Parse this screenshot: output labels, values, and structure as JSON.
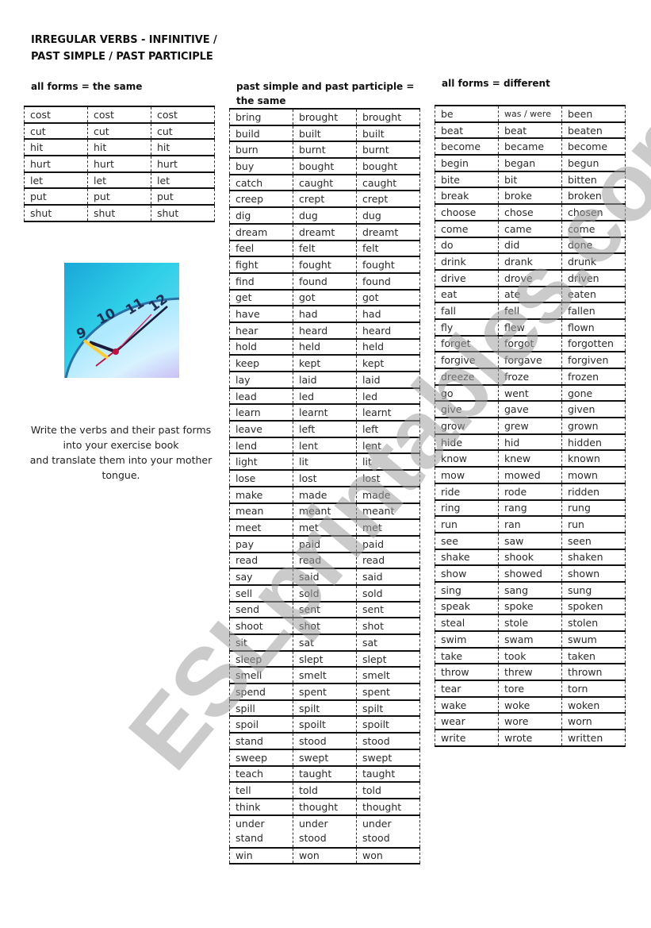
{
  "title_lines": [
    "IRREGULAR VERBS - INFINITIVE /",
    "PAST SIMPLE / PAST PARTICIPLE"
  ],
  "sections": {
    "same": {
      "heading": "all forms = the same",
      "rows": [
        [
          "cost",
          "cost",
          "cost"
        ],
        [
          "cut",
          "cut",
          "cut"
        ],
        [
          "hit",
          "hit",
          "hit"
        ],
        [
          "hurt",
          "hurt",
          "hurt"
        ],
        [
          "let",
          "let",
          "let"
        ],
        [
          "put",
          "put",
          "put"
        ],
        [
          "shut",
          "shut",
          "shut"
        ]
      ]
    },
    "past_same": {
      "heading_lines": [
        "past simple and past participle =",
        "the same"
      ],
      "rows": [
        [
          "bring",
          "brought",
          "brought"
        ],
        [
          "build",
          "built",
          "built"
        ],
        [
          "burn",
          "burnt",
          "burnt"
        ],
        [
          "buy",
          "bought",
          "bought"
        ],
        [
          "catch",
          "caught",
          "caught"
        ],
        [
          "creep",
          "crept",
          "crept"
        ],
        [
          "dig",
          "dug",
          "dug"
        ],
        [
          "dream",
          "dreamt",
          "dreamt"
        ],
        [
          "feel",
          "felt",
          "felt"
        ],
        [
          "fight",
          "fought",
          "fought"
        ],
        [
          "find",
          "found",
          "found"
        ],
        [
          "get",
          "got",
          "got"
        ],
        [
          "have",
          "had",
          "had"
        ],
        [
          "hear",
          "heard",
          "heard"
        ],
        [
          "hold",
          "held",
          "held"
        ],
        [
          "keep",
          "kept",
          "kept"
        ],
        [
          "lay",
          "laid",
          "laid"
        ],
        [
          "lead",
          "led",
          "led"
        ],
        [
          "learn",
          "learnt",
          "learnt"
        ],
        [
          "leave",
          "left",
          "left"
        ],
        [
          "lend",
          "lent",
          "lent"
        ],
        [
          "light",
          "lit",
          "lit"
        ],
        [
          "lose",
          "lost",
          "lost"
        ],
        [
          "make",
          "made",
          "made"
        ],
        [
          "mean",
          "meant",
          "meant"
        ],
        [
          "meet",
          "met",
          "met"
        ],
        [
          "pay",
          "paid",
          "paid"
        ],
        [
          "read",
          "read",
          "read"
        ],
        [
          "say",
          "said",
          "said"
        ],
        [
          "sell",
          "sold",
          "sold"
        ],
        [
          "send",
          "sent",
          "sent"
        ],
        [
          "shoot",
          "shot",
          "shot"
        ],
        [
          "sit",
          "sat",
          "sat"
        ],
        [
          "sleep",
          "slept",
          "slept"
        ],
        [
          "smell",
          "smelt",
          "smelt"
        ],
        [
          "spend",
          "spent",
          "spent"
        ],
        [
          "spill",
          "spilt",
          "spilt"
        ],
        [
          "spoil",
          "spoilt",
          "spoilt"
        ],
        [
          "stand",
          "stood",
          "stood"
        ],
        [
          "sweep",
          "swept",
          "swept"
        ],
        [
          "teach",
          "taught",
          "taught"
        ],
        [
          "tell",
          "told",
          "told"
        ],
        [
          "think",
          "thought",
          "thought"
        ],
        [
          "under stand",
          "under stood",
          "under stood"
        ],
        [
          "win",
          "won",
          "won"
        ]
      ]
    },
    "different": {
      "heading": "all forms = different",
      "rows": [
        [
          "be",
          "was / were",
          "been"
        ],
        [
          "beat",
          "beat",
          "beaten"
        ],
        [
          "become",
          "became",
          "become"
        ],
        [
          "begin",
          "began",
          "begun"
        ],
        [
          "bite",
          "bit",
          "bitten"
        ],
        [
          "break",
          "broke",
          "broken"
        ],
        [
          "choose",
          "chose",
          "chosen"
        ],
        [
          "come",
          "came",
          "come"
        ],
        [
          "do",
          "did",
          "done"
        ],
        [
          "drink",
          "drank",
          "drunk"
        ],
        [
          "drive",
          "drove",
          "driven"
        ],
        [
          "eat",
          "ate",
          "eaten"
        ],
        [
          "fall",
          "fell",
          "fallen"
        ],
        [
          "fly",
          "flew",
          "flown"
        ],
        [
          "forget",
          "forgot",
          "forgotten"
        ],
        [
          "forgive",
          "forgave",
          "forgiven"
        ],
        [
          "dreeze",
          "froze",
          "frozen"
        ],
        [
          "go",
          "went",
          "gone"
        ],
        [
          "give",
          "gave",
          "given"
        ],
        [
          "grow",
          "grew",
          "grown"
        ],
        [
          "hide",
          "hid",
          "hidden"
        ],
        [
          "know",
          "knew",
          "known"
        ],
        [
          "mow",
          "mowed",
          "mown"
        ],
        [
          "ride",
          "rode",
          "ridden"
        ],
        [
          "ring",
          "rang",
          "rung"
        ],
        [
          "run",
          "ran",
          "run"
        ],
        [
          "see",
          "saw",
          "seen"
        ],
        [
          "shake",
          "shook",
          "shaken"
        ],
        [
          "show",
          "showed",
          "shown"
        ],
        [
          "sing",
          "sang",
          "sung"
        ],
        [
          "speak",
          "spoke",
          "spoken"
        ],
        [
          "steal",
          "stole",
          "stolen"
        ],
        [
          "swim",
          "swam",
          "swum"
        ],
        [
          "take",
          "took",
          "taken"
        ],
        [
          "throw",
          "threw",
          "thrown"
        ],
        [
          "tear",
          "tore",
          "torn"
        ],
        [
          "wake",
          "woke",
          "woken"
        ],
        [
          "wear",
          "wore",
          "worn"
        ],
        [
          "write",
          "wrote",
          "written"
        ]
      ]
    }
  },
  "image": {
    "description": "clock-face photo",
    "numerals": [
      "9",
      "10",
      "11",
      "12"
    ]
  },
  "instructions_lines": [
    "Write the verbs and their past forms",
    "into your exercise book",
    "and translate them into your mother",
    "tongue."
  ],
  "watermark": "ESLprintables.com"
}
